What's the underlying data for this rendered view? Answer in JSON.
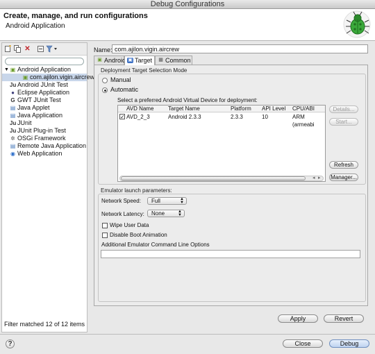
{
  "window": {
    "title": "Debug Configurations"
  },
  "header": {
    "title": "Create, manage, and run configurations",
    "subtitle": "Android Application"
  },
  "toolbar": {
    "icons": [
      "new-config-icon",
      "duplicate-icon",
      "delete-icon",
      "collapse-all-icon",
      "filter-icon"
    ]
  },
  "tree": {
    "items": [
      {
        "label": "Android Application",
        "icon": "android-icon",
        "expanded": true
      },
      {
        "label": "com.ajilon.vigin.aircrew",
        "icon": "config-icon",
        "child": true,
        "selected": true
      },
      {
        "label": "Android JUnit Test",
        "icon": "junit-icon"
      },
      {
        "label": "Eclipse Application",
        "icon": "eclipse-icon"
      },
      {
        "label": "GWT JUnit Test",
        "icon": "gwt-icon"
      },
      {
        "label": "Java Applet",
        "icon": "applet-icon"
      },
      {
        "label": "Java Application",
        "icon": "java-icon"
      },
      {
        "label": "JUnit",
        "icon": "junit-icon"
      },
      {
        "label": "JUnit Plug-in Test",
        "icon": "junit-icon"
      },
      {
        "label": "OSGi Framework",
        "icon": "osgi-icon"
      },
      {
        "label": "Remote Java Application",
        "icon": "remote-icon"
      },
      {
        "label": "Web Application",
        "icon": "web-icon"
      }
    ],
    "filter_status": "Filter matched 12 of 12 items"
  },
  "config": {
    "name_label": "Name:",
    "name_value": "com.ajilon.vigin.aircrew",
    "tabs": [
      {
        "label": "Android",
        "icon": "android-icon"
      },
      {
        "label": "Target",
        "icon": "target-icon",
        "active": true
      },
      {
        "label": "Common",
        "icon": "common-icon"
      }
    ]
  },
  "deployment": {
    "section_label": "Deployment Target Selection Mode",
    "manual_label": "Manual",
    "automatic_label": "Automatic",
    "selected_mode": "Automatic",
    "avd_prompt": "Select a preferred Android Virtual Device for deployment:",
    "columns": [
      "AVD Name",
      "Target Name",
      "Platform",
      "API Level",
      "CPU/ABI"
    ],
    "rows": [
      {
        "checked": true,
        "avd_name": "AVD_2_3",
        "target_name": "Android 2.3.3",
        "platform": "2.3.3",
        "api_level": "10",
        "cpu_abi": "ARM (armeabi"
      }
    ],
    "buttons": {
      "details": "Details...",
      "start": "Start...",
      "refresh": "Refresh",
      "manager": "Manager..."
    }
  },
  "emulator": {
    "section_label": "Emulator launch parameters:",
    "network_speed_label": "Network Speed:",
    "network_speed_value": "Full",
    "network_latency_label": "Network Latency:",
    "network_latency_value": "None",
    "wipe_label": "Wipe User Data",
    "disable_boot_label": "Disable Boot Animation",
    "additional_label": "Additional Emulator Command Line Options",
    "additional_value": ""
  },
  "actions": {
    "apply": "Apply",
    "revert": "Revert",
    "close": "Close",
    "debug": "Debug",
    "help": "?"
  }
}
